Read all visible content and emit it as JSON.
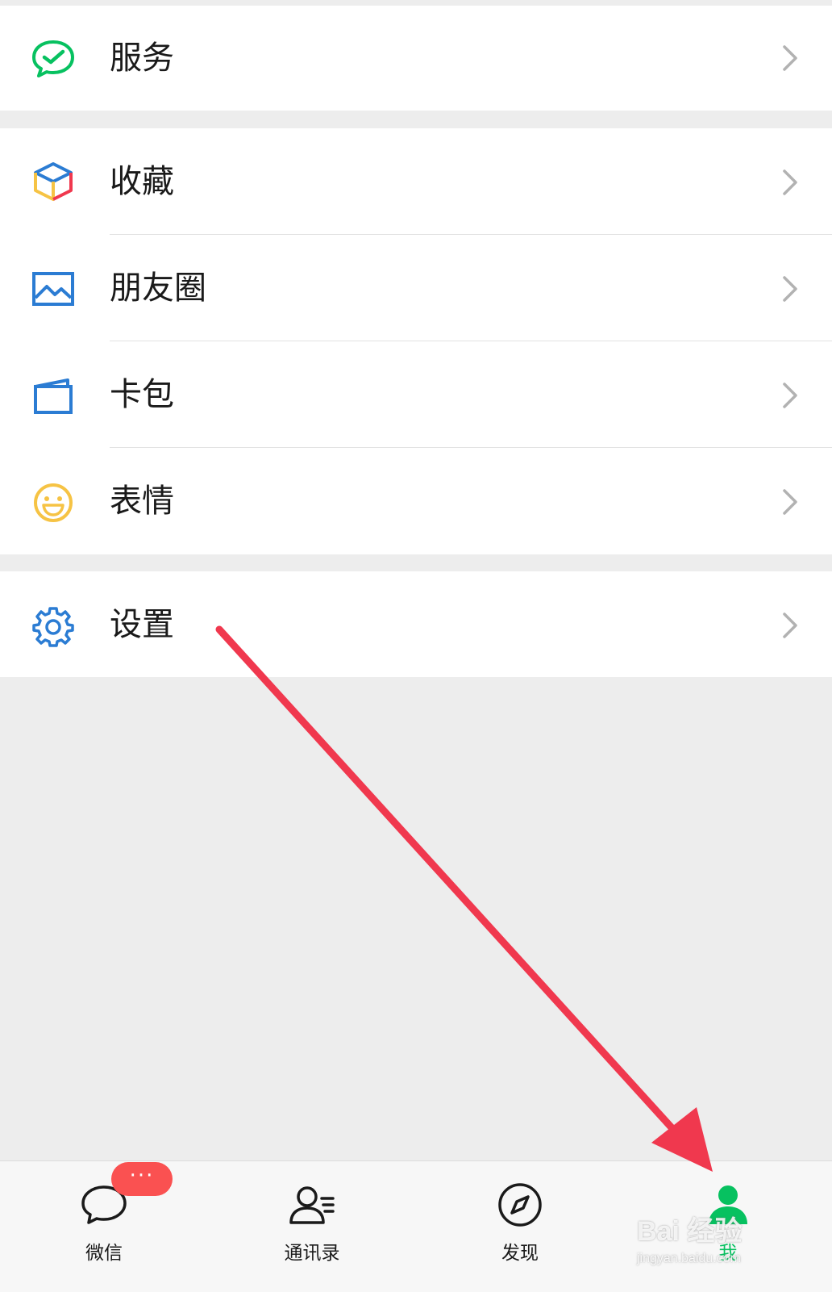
{
  "menu": {
    "service": {
      "label": "服务",
      "icon": "wechat-pay-check-icon",
      "color": "#07c160"
    },
    "favorites": {
      "label": "收藏",
      "icon": "cube-icon"
    },
    "moments": {
      "label": "朋友圈",
      "icon": "image-icon",
      "color": "#2b7cd3"
    },
    "cards": {
      "label": "卡包",
      "icon": "card-wallet-icon",
      "color": "#2b7cd3"
    },
    "stickers": {
      "label": "表情",
      "icon": "smiley-icon",
      "color": "#f6c344"
    },
    "settings": {
      "label": "设置",
      "icon": "gear-icon",
      "color": "#2b7cd3"
    }
  },
  "tabbar": {
    "chats": {
      "label": "微信",
      "icon": "chat-bubble-icon",
      "badge": "···"
    },
    "contacts": {
      "label": "通讯录",
      "icon": "contacts-icon"
    },
    "discover": {
      "label": "发现",
      "icon": "compass-icon"
    },
    "me": {
      "label": "我",
      "icon": "person-icon",
      "active": true,
      "color": "#07c160"
    }
  },
  "annotation": {
    "arrow_color": "#f0384e"
  },
  "watermark": {
    "line1": "Bai 经验",
    "line2": "jingyan.baidu.com"
  }
}
